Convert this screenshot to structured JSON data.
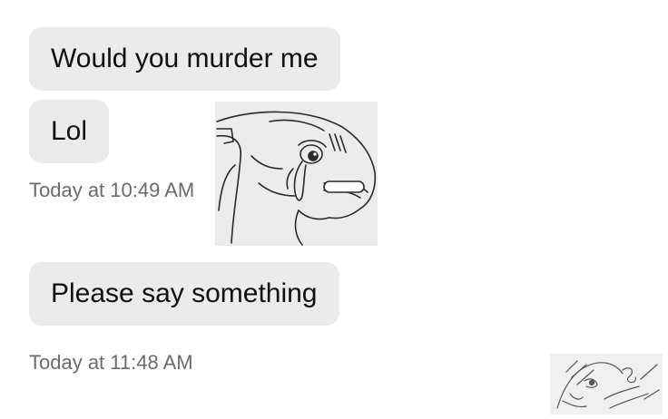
{
  "conversation": {
    "messages": [
      {
        "text": "Would you murder me"
      },
      {
        "text": "Lol"
      },
      {
        "text": "Please say something"
      }
    ],
    "timestamps": [
      {
        "label": "Today at 10:49 AM"
      },
      {
        "label": "Today at 11:48 AM"
      }
    ],
    "stickers": [
      {
        "icon": "crying-creature-sticker"
      },
      {
        "icon": "sketch-face-sticker"
      }
    ]
  }
}
